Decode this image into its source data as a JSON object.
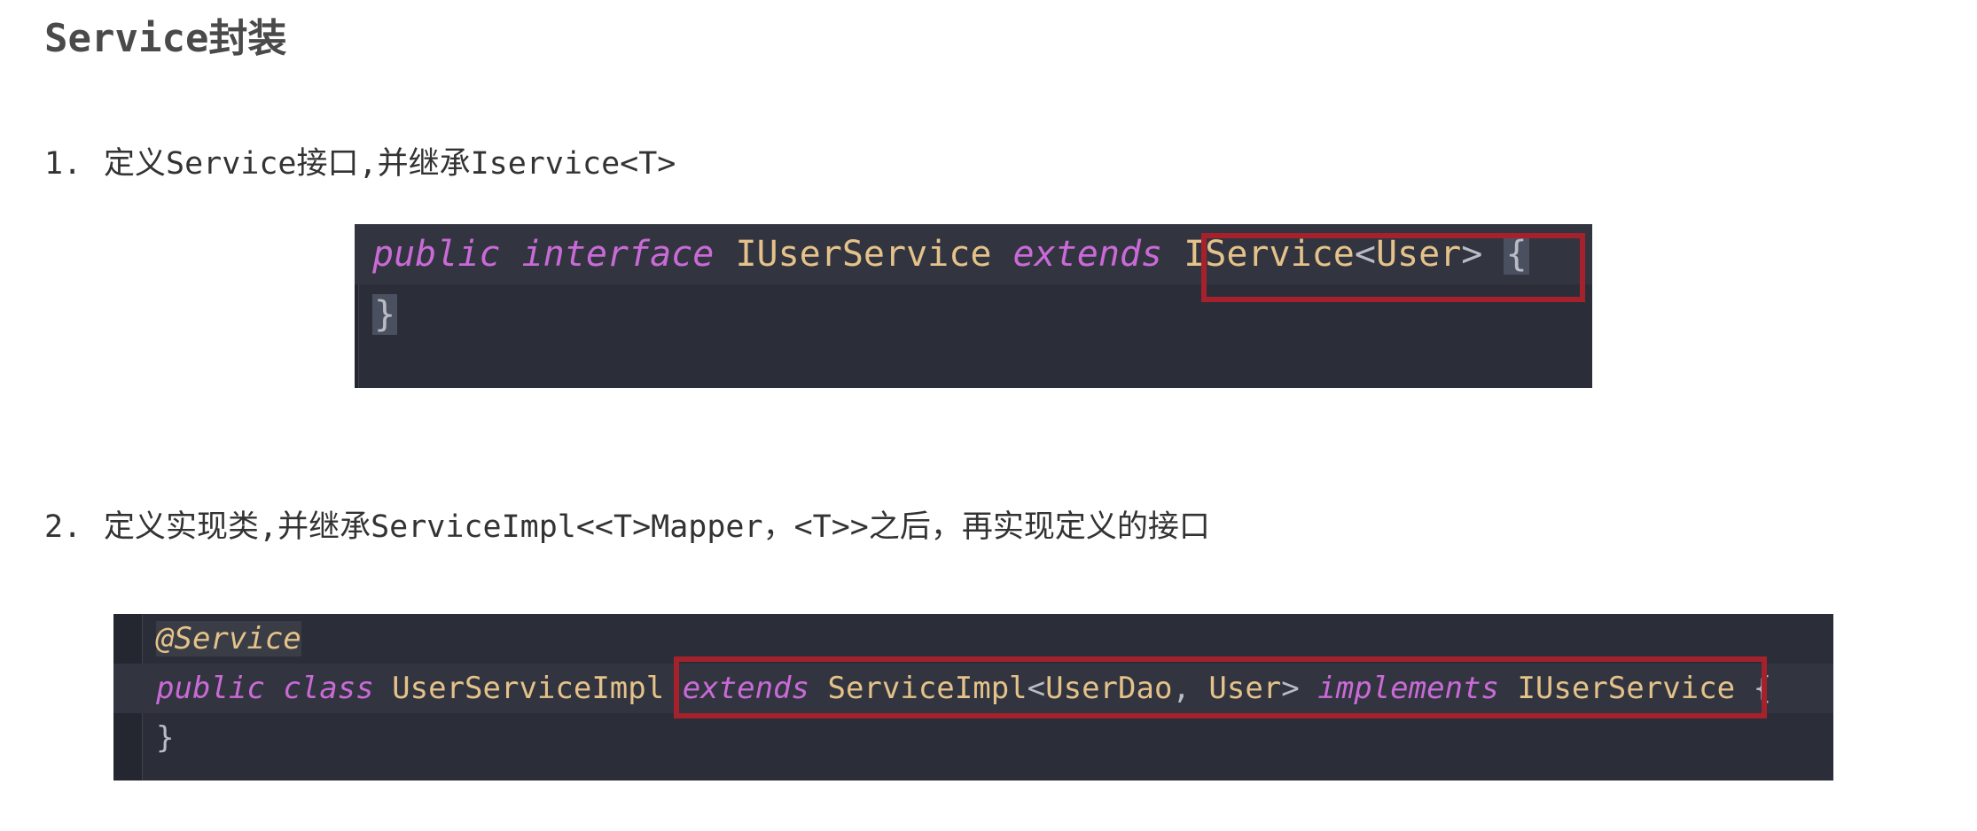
{
  "section": {
    "title": "Service封装"
  },
  "steps": [
    {
      "number": "1.",
      "text": "定义Service接口,并继承Iservice<T>",
      "code": {
        "line1": {
          "kw1": "public",
          "kw2": "interface",
          "name": "IUserService",
          "kw3": "extends",
          "base": "IService",
          "lt": "<",
          "generic": "User",
          "gt": ">",
          "brace": "{"
        },
        "line2": {
          "brace": "}"
        }
      }
    },
    {
      "number": "2.",
      "text": "定义实现类,并继承ServiceImpl<<T>Mapper，<T>>之后，再实现定义的接口",
      "code": {
        "line1": {
          "annotation": "@Service"
        },
        "line2": {
          "kw1": "public",
          "kw2": "class",
          "name": "UserServiceImpl",
          "kw3": "extends",
          "base": "ServiceImpl",
          "lt": "<",
          "g1": "UserDao",
          "comma": ",",
          "g2": "User",
          "gt": ">",
          "kw4": "implements",
          "iface": "IUserService",
          "brace": "{"
        },
        "line3": {
          "brace": "}"
        }
      }
    }
  ],
  "colors": {
    "highlight_box": "#a5212b",
    "keyword": "#c96ad7",
    "type": "#e4c28a",
    "code_bg": "#2b2e38"
  }
}
